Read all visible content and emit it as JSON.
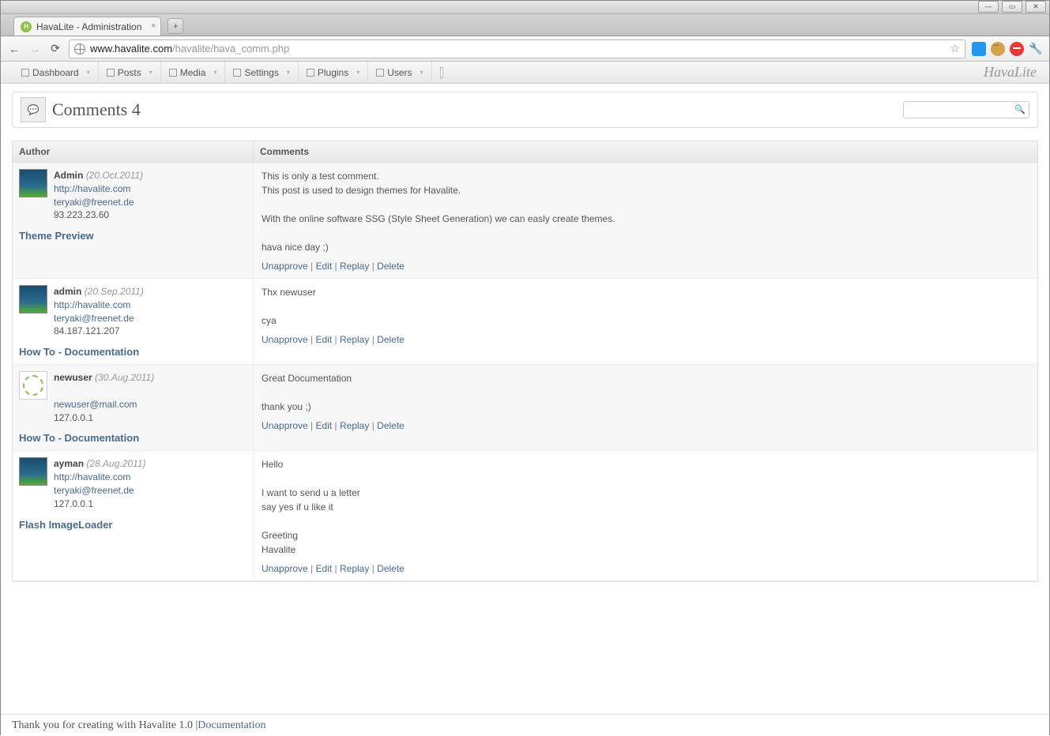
{
  "browser": {
    "tab_title": "HavaLite - Administration",
    "url_host": "www.havalite.com",
    "url_path": "/havalite/hava_comm.php"
  },
  "admin_nav": {
    "items": [
      {
        "label": "Dashboard"
      },
      {
        "label": "Posts"
      },
      {
        "label": "Media"
      },
      {
        "label": "Settings"
      },
      {
        "label": "Plugins"
      },
      {
        "label": "Users"
      }
    ],
    "brand": "HavaLite"
  },
  "page": {
    "title": "Comments 4",
    "search_placeholder": ""
  },
  "table": {
    "headers": {
      "author": "Author",
      "comments": "Comments"
    },
    "rows": [
      {
        "author": {
          "name": "Admin",
          "date": "(20.Oct.2011)",
          "url": "http://havalite.com",
          "email": "teryaki@freenet.de",
          "ip": "93.223.23.60",
          "avatar": "default"
        },
        "post": "Theme Preview",
        "body": "This is only a test comment.\nThis post is used to design themes for Havalite.\n\nWith the online software SSG (Style Sheet Generation) we can easly create themes.\n\nhava nice day ;)",
        "actions": [
          "Unapprove",
          "Edit",
          "Replay",
          "Delete"
        ]
      },
      {
        "author": {
          "name": "admin",
          "date": "(20.Sep.2011)",
          "url": "http://havalite.com",
          "email": "teryaki@freenet.de",
          "ip": "84.187.121.207",
          "avatar": "default"
        },
        "post": "How To - Documentation",
        "body": "Thx newuser\n\ncya",
        "actions": [
          "Unapprove",
          "Edit",
          "Replay",
          "Delete"
        ]
      },
      {
        "author": {
          "name": "newuser",
          "date": "(30.Aug.2011)",
          "url": "",
          "email": "newuser@mail.com",
          "ip": "127.0.0.1",
          "avatar": "pattern"
        },
        "post": "How To - Documentation",
        "body": "Great Documentation\n\nthank you ;)",
        "actions": [
          "Unapprove",
          "Edit",
          "Replay",
          "Delete"
        ]
      },
      {
        "author": {
          "name": "ayman",
          "date": "(28.Aug.2011)",
          "url": "http://havalite.com",
          "email": "teryaki@freenet.de",
          "ip": "127.0.0.1",
          "avatar": "default"
        },
        "post": "Flash ImageLoader",
        "body": "Hello\n\nI want to send u a letter\nsay yes if u like it\n\nGreeting\nHavalite",
        "actions": [
          "Unapprove",
          "Edit",
          "Replay",
          "Delete"
        ]
      }
    ]
  },
  "footer": {
    "text": "Thank you for creating with Havalite 1.0 | ",
    "link": "Documentation"
  }
}
